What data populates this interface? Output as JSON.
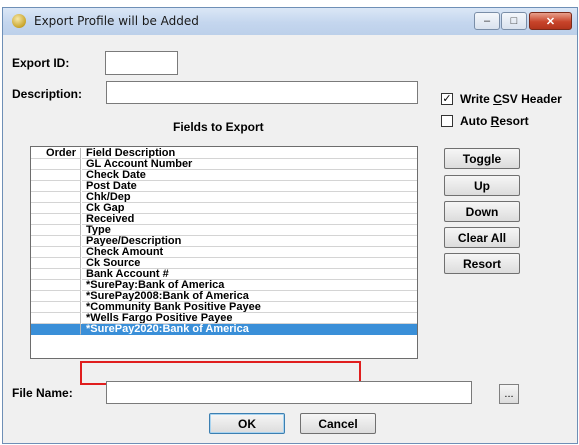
{
  "window": {
    "title": "Export Profile will be Added",
    "controls": {
      "minimize": "–",
      "maximize": "□",
      "close": "✕"
    }
  },
  "form": {
    "export_id_label": "Export ID:",
    "export_id_value": "",
    "description_label": "Description:",
    "description_value": "",
    "write_csv_header": {
      "label_pre": "Write ",
      "label_u": "C",
      "label_post": "SV Header",
      "checked": true,
      "mark": "✓"
    },
    "auto_resort": {
      "label_pre": "Auto ",
      "label_u": "R",
      "label_post": "esort",
      "checked": false,
      "mark": ""
    },
    "file_name_label": "File Name:",
    "file_name_value": "",
    "browse_label": "..."
  },
  "fields_grid": {
    "caption": "Fields to Export",
    "headers": {
      "order": "Order",
      "field": "Field Description"
    },
    "rows": [
      "GL Account Number",
      "Check Date",
      "Post Date",
      "Chk/Dep",
      "Ck Gap",
      "Received",
      "Type",
      "Payee/Description",
      "Check Amount",
      "Ck Source",
      "Bank Account #",
      "*SurePay:Bank of America",
      "*SurePay2008:Bank of America",
      "*Community Bank Positive Payee",
      "*Wells Fargo Positive Payee",
      "*SurePay2020:Bank of America"
    ],
    "selected_index": 15
  },
  "side_buttons": {
    "toggle": "Toggle",
    "up": "Up",
    "down": "Down",
    "clear_all": "Clear All",
    "resort": "Resort"
  },
  "footer_buttons": {
    "ok": "OK",
    "cancel": "Cancel"
  },
  "colors": {
    "selection": "#3a8fd8",
    "highlight": "#e01e1e"
  }
}
